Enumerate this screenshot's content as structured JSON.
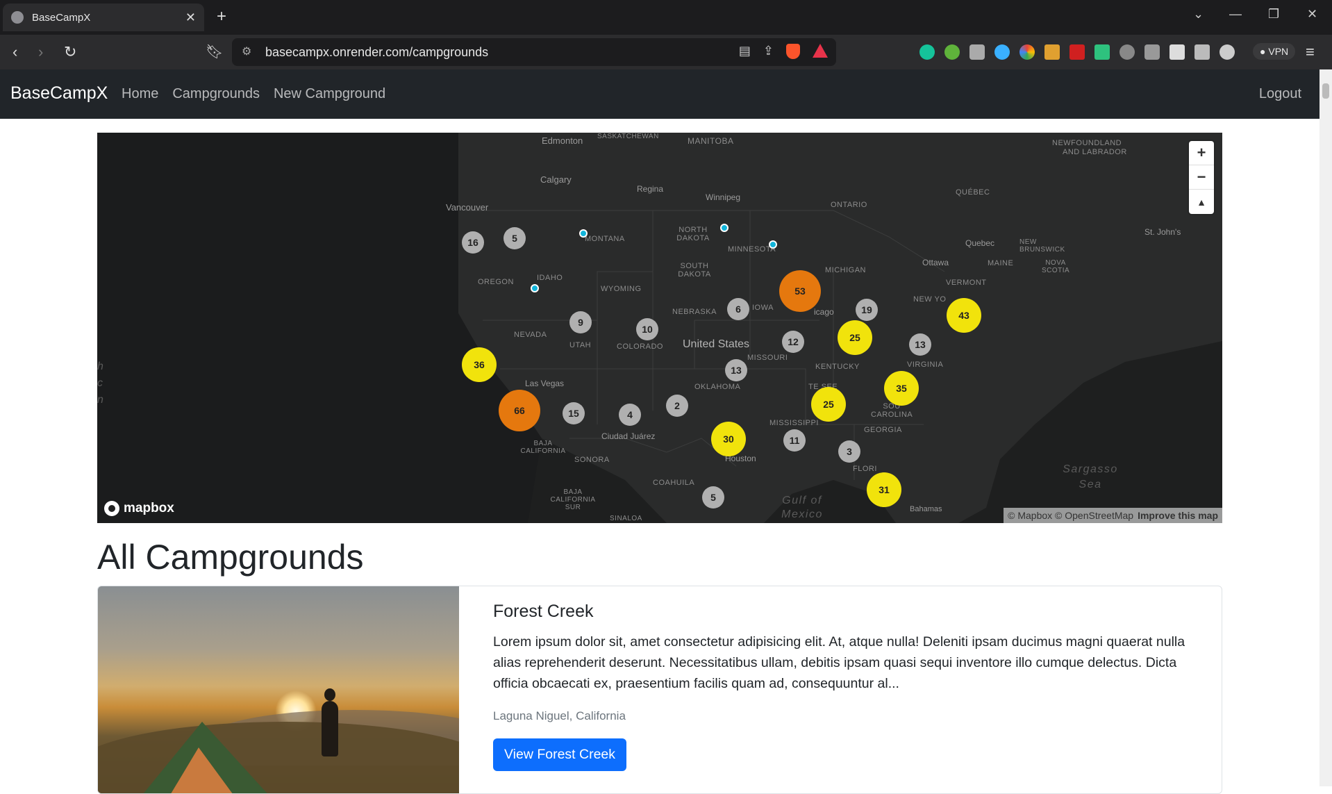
{
  "browser": {
    "tab_title": "BaseCampX",
    "url": "basecampx.onrender.com/campgrounds",
    "vpn_label": "VPN"
  },
  "navbar": {
    "brand": "BaseCampX",
    "links": [
      "Home",
      "Campgrounds",
      "New Campground"
    ],
    "logout": "Logout"
  },
  "map": {
    "provider": "mapbox",
    "attribution": "© Mapbox © OpenStreetMap",
    "improve": "Improve this map",
    "labels": {
      "edmonton": "Edmonton",
      "saskatchewan": "SASKATCHEWAN",
      "manitoba": "MANITOBA",
      "newfoundland": "NEWFOUNDLAND",
      "labrador": "AND LABRADOR",
      "calgary": "Calgary",
      "regina": "Regina",
      "winnipeg": "Winnipeg",
      "quebec_prov": "QUÉBEC",
      "ontario": "ONTARIO",
      "vancouver": "Vancouver",
      "north_dakota": "NORTH DAKOTA",
      "montana": "MONTANA",
      "minnesota": "MINNESOTA",
      "quebec": "Quebec",
      "new_brunswick": "NEW BRUNSWICK",
      "st_johns": "St. John's",
      "south_dakota": "SOUTH DAKOTA",
      "oregon": "OREGON",
      "idaho": "IDAHO",
      "michigan": "MICHIGAN",
      "ottawa": "Ottawa",
      "maine": "MAINE",
      "nova_scotia": "NOVA SCOTIA",
      "vermont": "VERMONT",
      "wyoming": "WYOMING",
      "new_york": "NEW YO",
      "nebraska": "NEBRASKA",
      "iowa": "IOWA",
      "chicago": "icago",
      "nevada": "NEVADA",
      "utah": "UTAH",
      "colorado": "COLORADO",
      "united_states": "United States",
      "missouri": "MISSOURI",
      "kentucky": "KENTUCKY",
      "virginia": "VIRGINIA",
      "las_vegas": "Las Vegas",
      "oklahoma": "OKLAHOMA",
      "tennessee": "TE    SEE",
      "south_carolina": "SOU    CAROLINA",
      "ciudad_juarez": "Ciudad Juárez",
      "mississippi": "MISSISSIPPI",
      "georgia": "GEORGIA",
      "baja_california": "BAJA CALIFORNIA",
      "sonora": "SONORA",
      "houston": "Houston",
      "florida": "FLORI",
      "coahuila": "COAHUILA",
      "baja_california_sur": "BAJA CALIFORNIA SUR",
      "sinaloa": "SINALOA",
      "gulf_of_mexico": "Gulf of Mexico",
      "sargasso_sea": "Sargasso Sea",
      "bahamas": "Bahamas",
      "pacific": "h c n"
    },
    "clusters": [
      {
        "count": "16",
        "level": "small"
      },
      {
        "count": "5",
        "level": "small"
      },
      {
        "count": "53",
        "level": "large"
      },
      {
        "count": "6",
        "level": "small"
      },
      {
        "count": "19",
        "level": "small"
      },
      {
        "count": "43",
        "level": "medium"
      },
      {
        "count": "9",
        "level": "small"
      },
      {
        "count": "10",
        "level": "small"
      },
      {
        "count": "25",
        "level": "medium"
      },
      {
        "count": "12",
        "level": "small"
      },
      {
        "count": "13",
        "level": "small"
      },
      {
        "count": "36",
        "level": "medium"
      },
      {
        "count": "13",
        "level": "small"
      },
      {
        "count": "35",
        "level": "medium"
      },
      {
        "count": "66",
        "level": "large"
      },
      {
        "count": "15",
        "level": "small"
      },
      {
        "count": "4",
        "level": "small"
      },
      {
        "count": "2",
        "level": "small"
      },
      {
        "count": "25",
        "level": "medium"
      },
      {
        "count": "30",
        "level": "medium"
      },
      {
        "count": "11",
        "level": "small"
      },
      {
        "count": "3",
        "level": "small"
      },
      {
        "count": "31",
        "level": "medium"
      },
      {
        "count": "5",
        "level": "small"
      }
    ],
    "colors": {
      "small": "#b0b0b0",
      "medium": "#f1e30c",
      "large": "#e5780e",
      "point": "#11b4da"
    }
  },
  "page": {
    "heading": "All Campgrounds"
  },
  "campgrounds": [
    {
      "title": "Forest Creek",
      "description": "Lorem ipsum dolor sit, amet consectetur adipisicing elit. At, atque nulla! Deleniti ipsam ducimus magni quaerat nulla alias reprehenderit deserunt. Necessitatibus ullam, debitis ipsam quasi sequi inventore illo cumque delectus. Dicta officia obcaecati ex, praesentium facilis quam ad, consequuntur al...",
      "location": "Laguna Niguel, California",
      "button": "View Forest Creek"
    }
  ]
}
